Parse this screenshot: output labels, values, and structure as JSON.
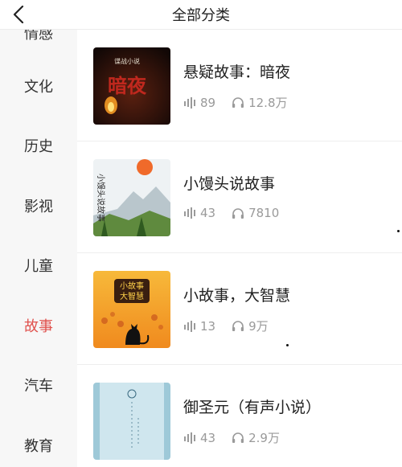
{
  "header": {
    "title": "全部分类"
  },
  "sidebar": {
    "items": [
      {
        "label": "情感"
      },
      {
        "label": "文化"
      },
      {
        "label": "历史"
      },
      {
        "label": "影视"
      },
      {
        "label": "儿童"
      },
      {
        "label": "故事"
      },
      {
        "label": "汽车"
      },
      {
        "label": "教育"
      }
    ],
    "active_index": 5
  },
  "list": {
    "items": [
      {
        "title": "悬疑故事：暗夜",
        "tracks": "89",
        "plays": "12.8万",
        "cover": {
          "tag": "谍战小说",
          "big_text": "暗夜"
        }
      },
      {
        "title": "小馒头说故事",
        "tracks": "43",
        "plays": "7810",
        "cover": {
          "big_text": "小馒头说故事"
        }
      },
      {
        "title": "小故事，大智慧",
        "tracks": "13",
        "plays": "9万",
        "cover": {
          "line1": "小故事",
          "line2": "大智慧"
        }
      },
      {
        "title": "御圣元（有声小说）",
        "tracks": "43",
        "plays": "2.9万",
        "cover": {}
      }
    ]
  },
  "colors": {
    "active": "#e0524e",
    "meta": "#9a9a9a",
    "sidebar_bg": "#f7f7f7"
  },
  "icons": {
    "tracks": "sound-bars-icon",
    "plays": "headphones-icon",
    "back": "chevron-left-icon"
  }
}
